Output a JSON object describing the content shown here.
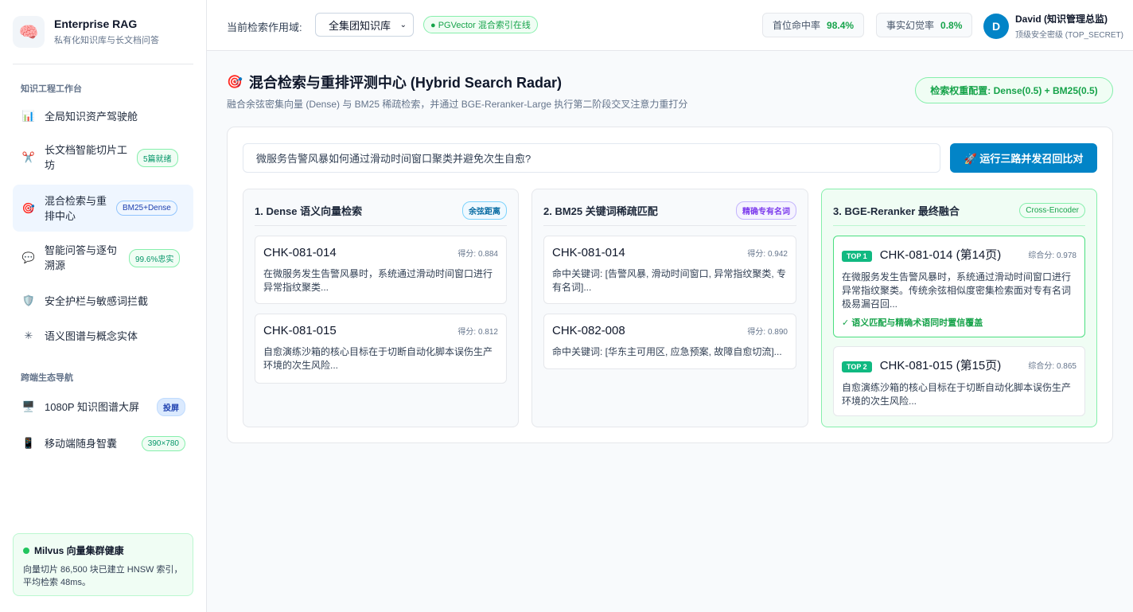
{
  "brand": {
    "title": "Enterprise RAG",
    "subtitle": "私有化知识库与长文档问答"
  },
  "sidebar": {
    "section1": "知识工程工作台",
    "section2": "跨端生态导航",
    "items": [
      {
        "label": "全局知识资产驾驶舱",
        "icon": "bar-chart-icon",
        "badge": ""
      },
      {
        "label": "长文档智能切片工坊",
        "icon": "scissors-icon",
        "badge": "5篇就绪"
      },
      {
        "label": "混合检索与重排中心",
        "icon": "target-icon",
        "badge": "BM25+Dense"
      },
      {
        "label": "智能问答与逐句溯源",
        "icon": "chat-bubble-icon",
        "badge": "99.6%忠实"
      },
      {
        "label": "安全护栏与敏感词拦截",
        "icon": "shield-icon",
        "badge": ""
      },
      {
        "label": "语义图谱与概念实体",
        "icon": "graph-icon",
        "badge": ""
      },
      {
        "label": "1080P 知识图谱大屏",
        "icon": "monitor-icon",
        "badge": "投屏"
      },
      {
        "label": "移动端随身智囊",
        "icon": "mobile-icon",
        "badge": "390×780"
      }
    ],
    "health": {
      "title": "Milvus 向量集群健康",
      "desc": "向量切片 86,500 块已建立 HNSW 索引，平均检索 48ms。"
    }
  },
  "topbar": {
    "scope_label": "当前检索作用域:",
    "scope_value": "全集团知识库",
    "pg_badge": "● PGVector 混合索引在线",
    "metric1_label": "首位命中率",
    "metric1_value": "98.4%",
    "metric2_label": "事实幻觉率",
    "metric2_value": "0.8%",
    "avatar_letter": "D",
    "user_name": "David (知识管理总监)",
    "user_clearance": "顶级安全密级 (TOP_SECRET)"
  },
  "main": {
    "title": "混合检索与重排评测中心 (Hybrid Search Radar)",
    "subtitle": "融合余弦密集向量 (Dense) 与 BM25 稀疏检索，并通过 BGE-Reranker-Large 执行第二阶段交叉注意力重打分",
    "weight_badge": "检索权重配置: Dense(0.5) + BM25(0.5)",
    "query": "微服务告警风暴如何通过滑动时间窗口聚类并避免次生自愈?",
    "run_button": "🚀 运行三路并发召回比对",
    "columns": [
      {
        "title": "1. Dense 语义向量检索",
        "tag": "余弦距离",
        "cards": [
          {
            "id": "CHK-081-014",
            "score": "得分: 0.884",
            "text": "在微服务发生告警风暴时，系统通过滑动时间窗口进行异常指纹聚类..."
          },
          {
            "id": "CHK-081-015",
            "score": "得分: 0.812",
            "text": "自愈演练沙箱的核心目标在于切断自动化脚本误伤生产环境的次生风险..."
          }
        ]
      },
      {
        "title": "2. BM25 关键词稀疏匹配",
        "tag": "精确专有名词",
        "cards": [
          {
            "id": "CHK-081-014",
            "score": "得分: 0.942",
            "text": "命中关键词: [告警风暴, 滑动时间窗口, 异常指纹聚类, 专有名词]..."
          },
          {
            "id": "CHK-082-008",
            "score": "得分: 0.890",
            "text": "命中关键词: [华东主可用区, 应急预案, 故障自愈切流]..."
          }
        ]
      },
      {
        "title": "3. BGE-Reranker 最终融合",
        "tag": "Cross-Encoder",
        "cards": [
          {
            "rank": "TOP 1",
            "id": "CHK-081-014 (第14页)",
            "score": "综合分: 0.978",
            "text": "在微服务发生告警风暴时，系统通过滑动时间窗口进行异常指纹聚类。传统余弦相似度密集检索面对专有名词极易漏召回...",
            "note": "✓ 语义匹配与精确术语同时置信覆盖"
          },
          {
            "rank": "TOP 2",
            "id": "CHK-081-015 (第15页)",
            "score": "综合分: 0.865",
            "text": "自愈演练沙箱的核心目标在于切断自动化脚本误伤生产环境的次生风险..."
          }
        ]
      }
    ]
  }
}
